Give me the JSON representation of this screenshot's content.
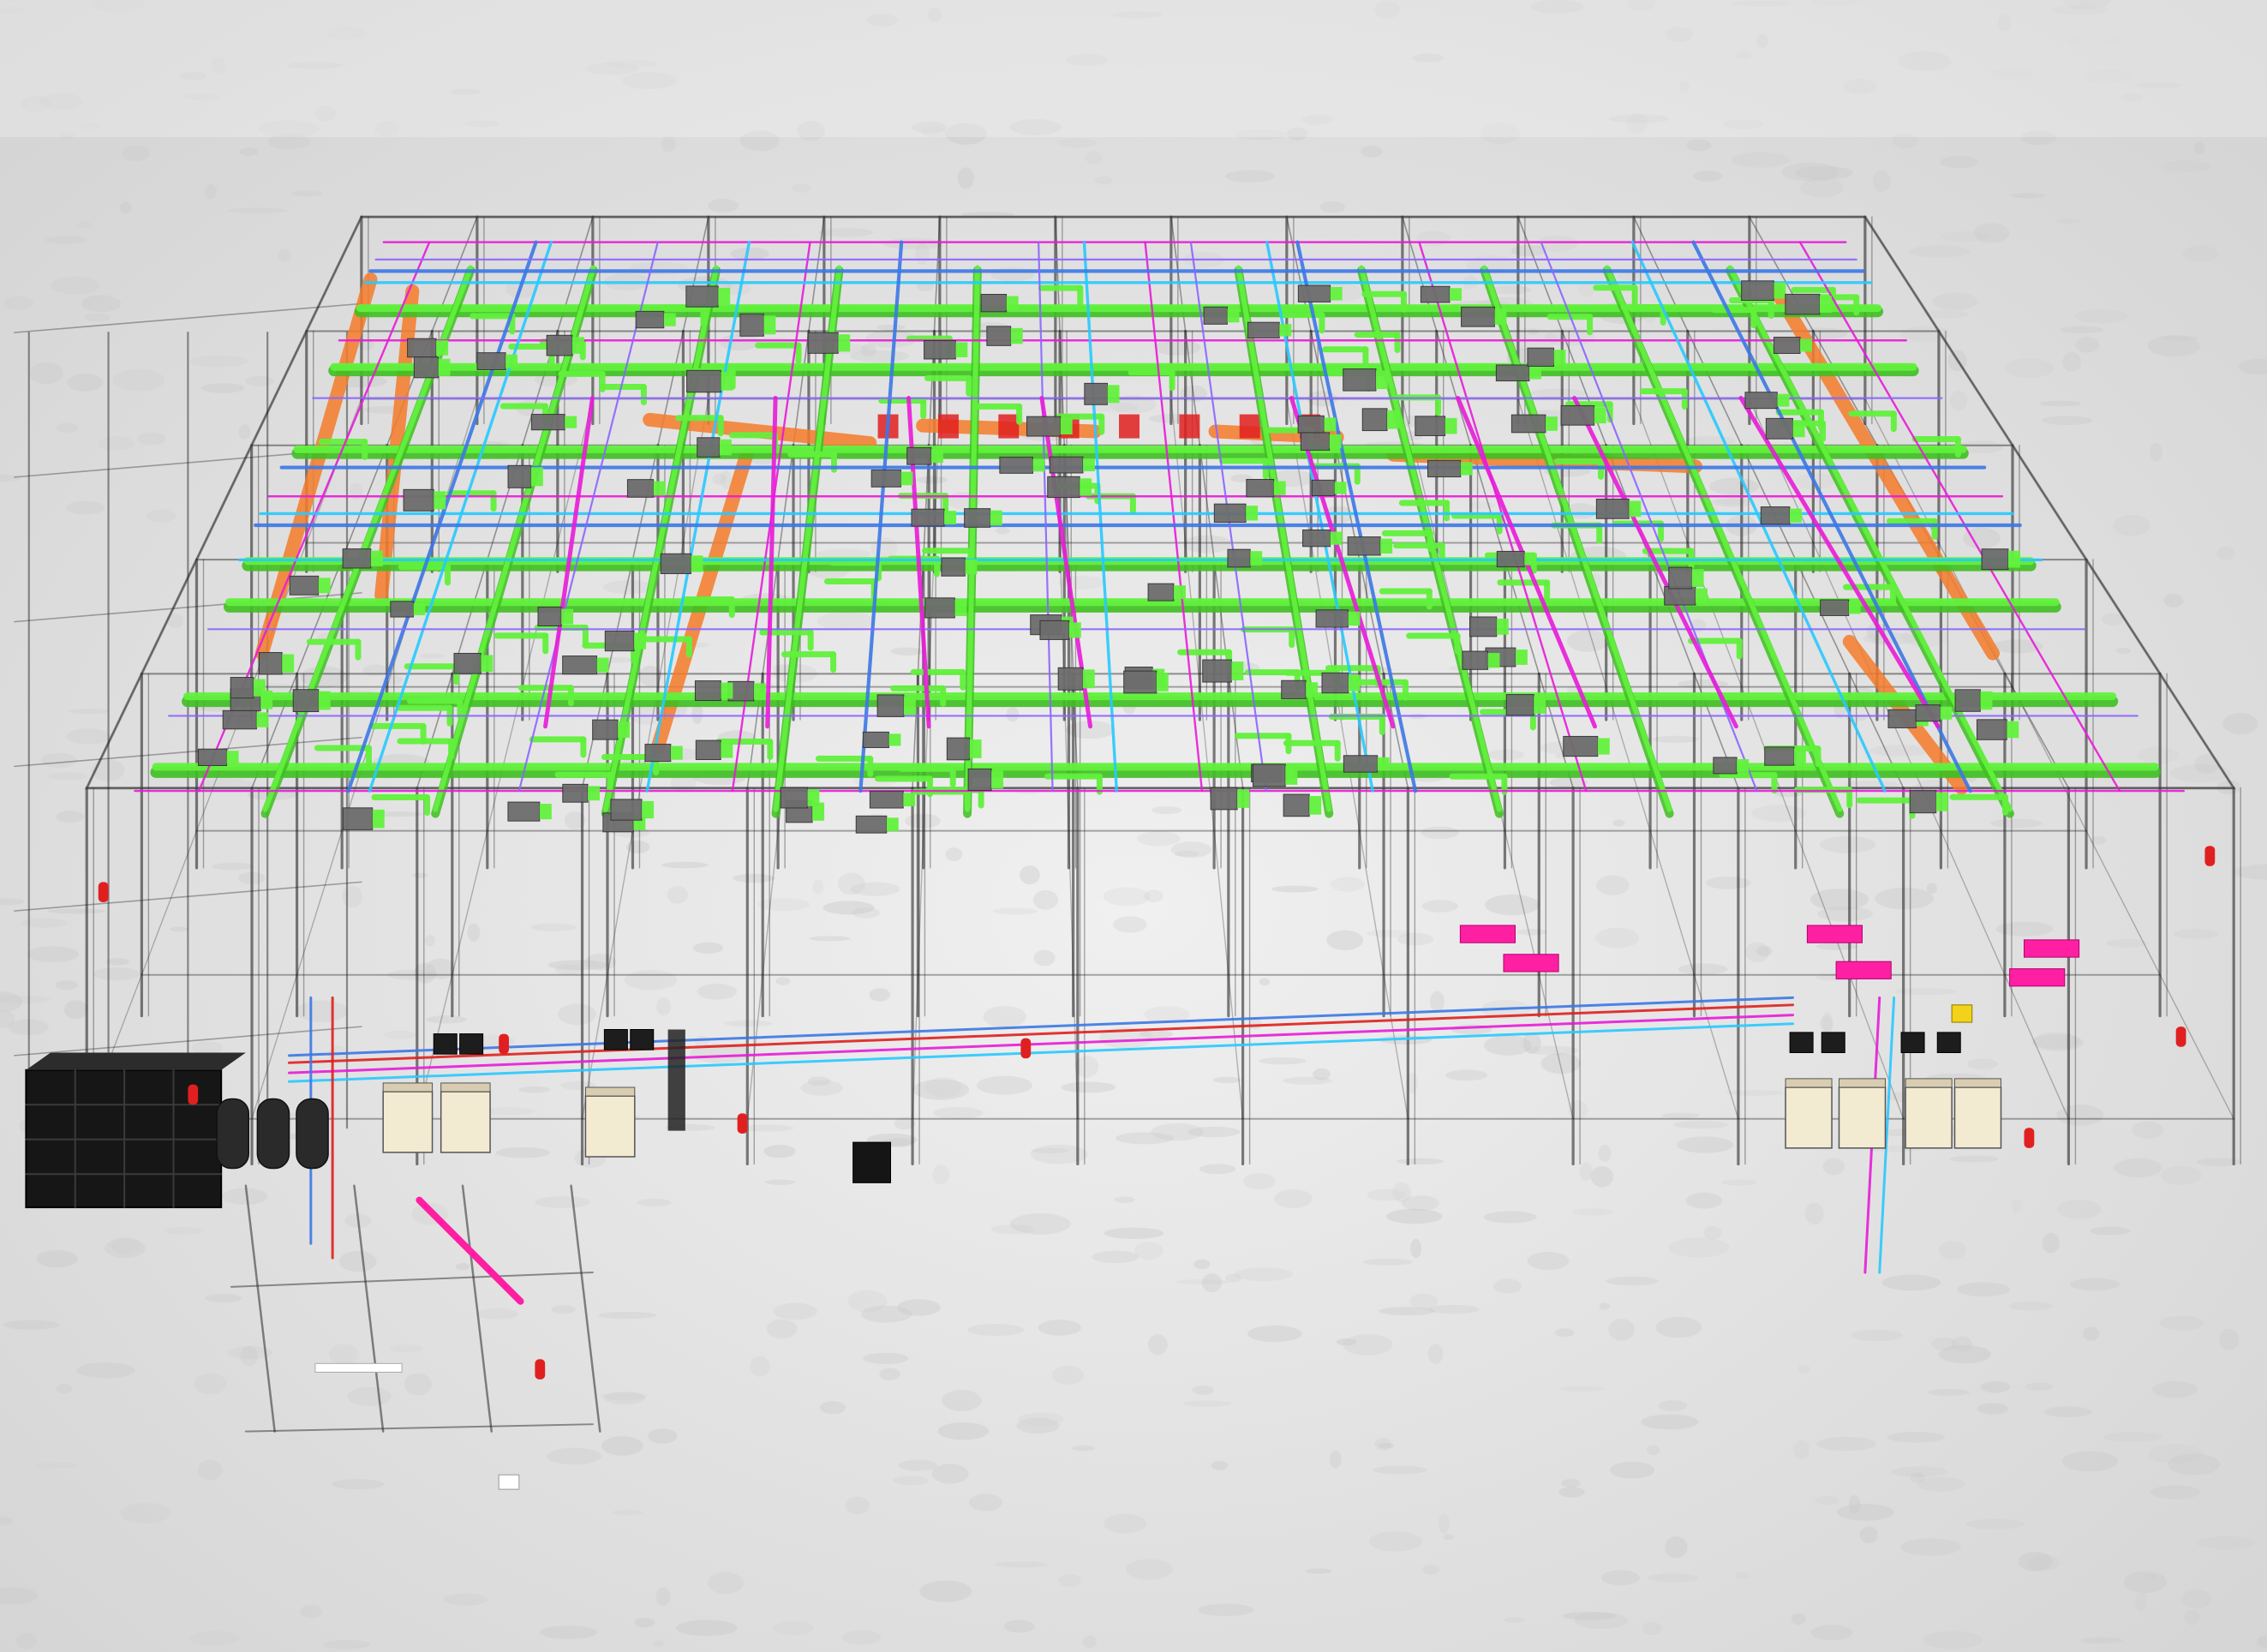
{
  "scene": {
    "subject": "bim-mep-3d-model",
    "view": "isometric-perspective",
    "colors": {
      "ground": "#e4e4e4",
      "ground_speckle": "#c9c9c9",
      "structure": "#1a1a1a",
      "duct_green": "#62f13d",
      "duct_green_dark": "#3fbf22",
      "pipe_magenta": "#e81cd8",
      "pipe_cyan": "#29c9ff",
      "pipe_blue": "#3c78e6",
      "pipe_violet": "#8b66ff",
      "pipe_red": "#e02020",
      "duct_orange": "#f57c2b",
      "pink_unit": "#ff1fa3",
      "equipment_gray": "#6d6d6d",
      "tank_black": "#161616",
      "tank_cream": "#f3ead2",
      "yellow_marker": "#f2d21a"
    },
    "layers": [
      {
        "name": "structural-frame",
        "icon": "steel-frame-icon"
      },
      {
        "name": "hvac-ductwork",
        "icon": "duct-icon"
      },
      {
        "name": "piping",
        "icon": "pipe-icon"
      },
      {
        "name": "equipment",
        "icon": "equipment-icon"
      }
    ]
  }
}
